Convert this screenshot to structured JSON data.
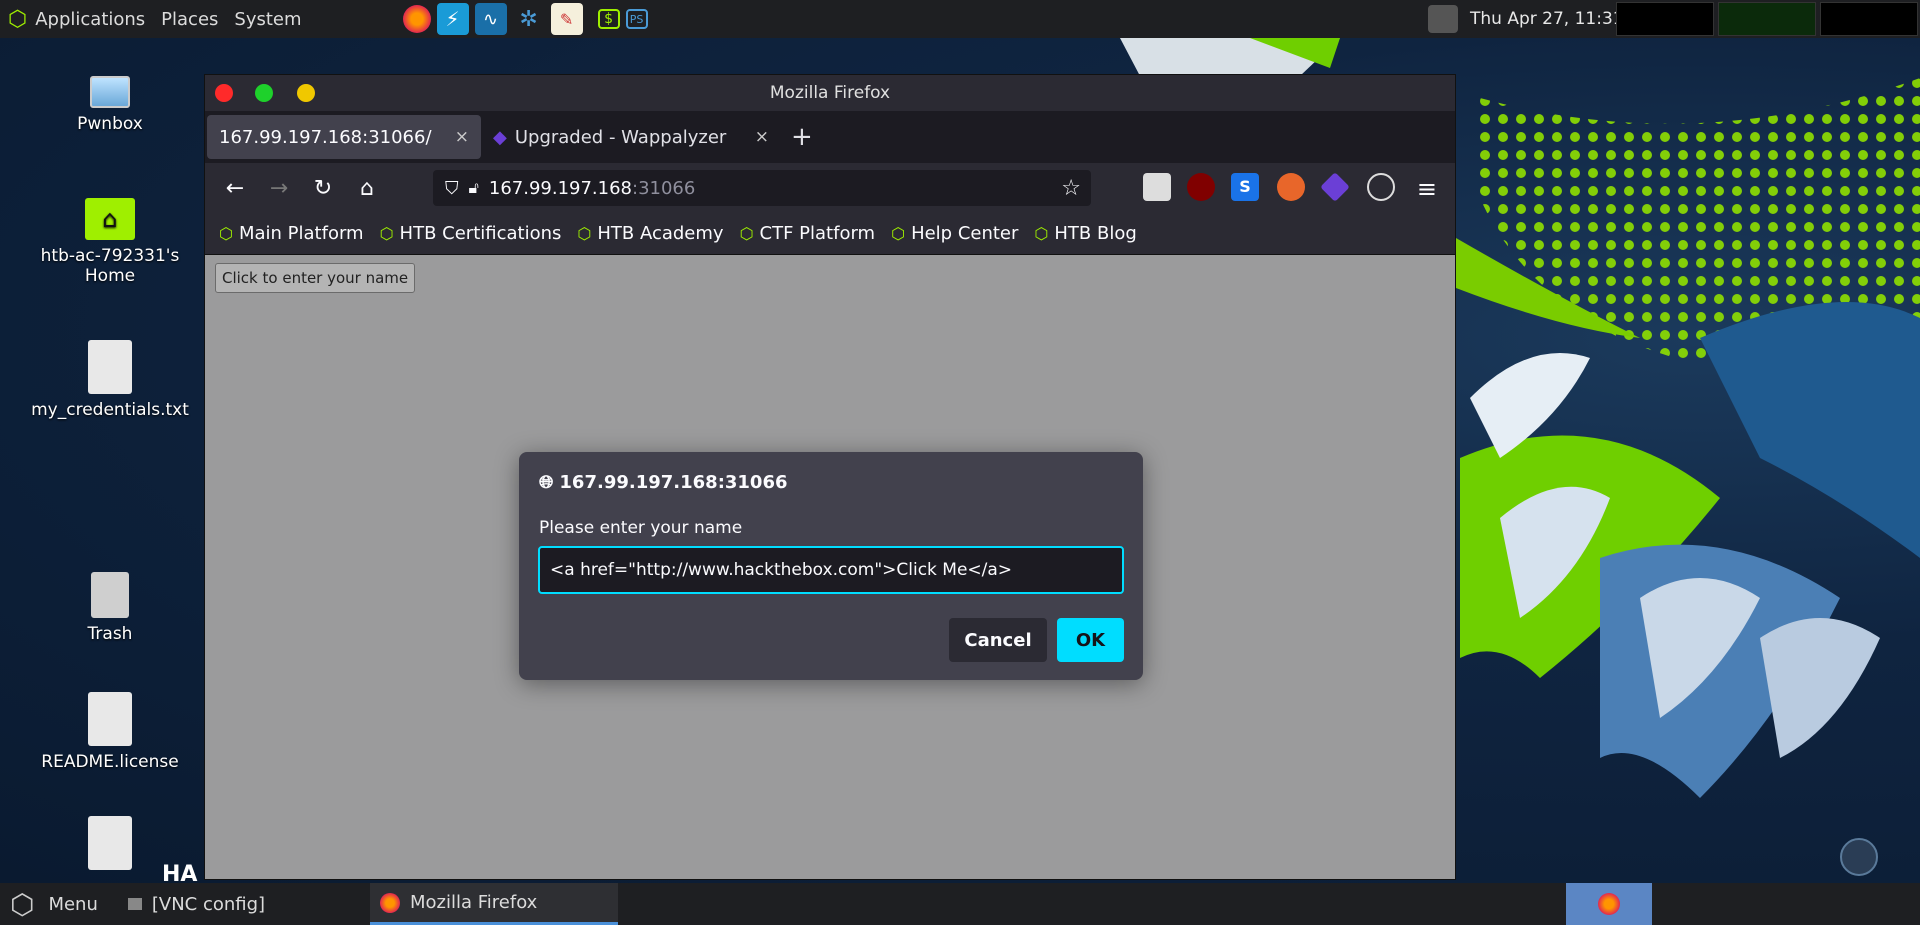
{
  "top_panel": {
    "applications": "Applications",
    "places": "Places",
    "system": "System",
    "clock": "Thu Apr 27, 11:31"
  },
  "desktop": {
    "icons": [
      {
        "label": "Pwnbox"
      },
      {
        "label": "htb-ac-792331's Home"
      },
      {
        "label": "my_credentials.txt"
      },
      {
        "label": "Trash"
      },
      {
        "label": "README.license"
      }
    ],
    "watermark": "HA"
  },
  "firefox": {
    "window_title": "Mozilla Firefox",
    "tabs": [
      {
        "label": "167.99.197.168:31066/",
        "close": "×"
      },
      {
        "label": "Upgraded - Wappalyzer",
        "close": "×"
      }
    ],
    "new_tab": "+",
    "url_host": "167.99.197.168",
    "url_port": ":31066",
    "bookmarks": [
      "Main Platform",
      "HTB Certifications",
      "HTB Academy",
      "CTF Platform",
      "Help Center",
      "HTB Blog"
    ],
    "page_button": "Click to enter your name"
  },
  "dialog": {
    "origin": "167.99.197.168:31066",
    "message": "Please enter your name",
    "input_value": "<a href=\"http://www.hackthebox.com\">Click Me</a>",
    "cancel": "Cancel",
    "ok": "OK"
  },
  "taskbar": {
    "menu": "Menu",
    "vnc": "[VNC config]",
    "firefox": "Mozilla Firefox"
  },
  "colors": {
    "accent": "#00ddff",
    "htb_green": "#9fef00",
    "panel": "#1e1f22"
  }
}
